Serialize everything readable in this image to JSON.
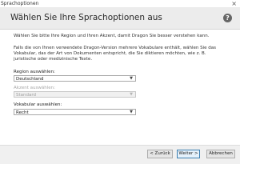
{
  "window": {
    "title": "Sprachoptionen",
    "close_glyph": "×"
  },
  "header": {
    "heading": "Wählen Sie Ihre Sprachoptionen aus",
    "help_glyph": "?"
  },
  "intro": "Wählen Sie bitte Ihre Region und Ihren Akzent, damit Dragon Sie besser verstehen kann.",
  "description": "Falls die von Ihnen verwendete Dragon-Version mehrere Vokabulare enthält, wählen Sie das Vokabular, das der Art von Dokumenten entspricht, die Sie diktieren möchten, wie z. B. juristische oder medizinische Texte.",
  "region": {
    "label": "Region auswählen:",
    "value": "Deutschland"
  },
  "accent": {
    "label": "Akzent auswählen:",
    "value": "Standard"
  },
  "vocabulary": {
    "label": "Vokabular auswählen:",
    "value": "Recht"
  },
  "buttons": {
    "back": "< Zurück",
    "next": "Weiter >",
    "cancel": "Abbrechen"
  },
  "icons": {
    "help": "help-icon",
    "close": "close-icon",
    "dropdown": "chevron-down-icon"
  }
}
